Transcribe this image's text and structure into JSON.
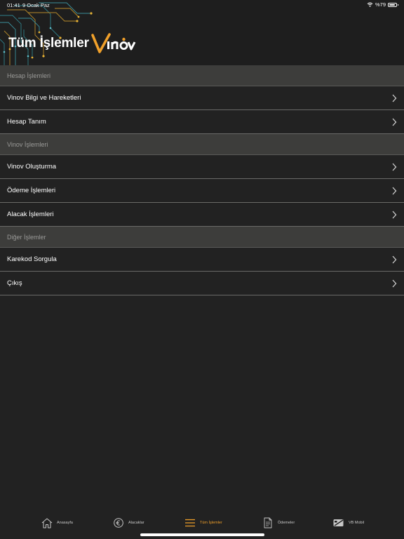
{
  "status_bar": {
    "time": "01:41",
    "date": "9 Ocak Paz",
    "battery": "%79"
  },
  "header": {
    "title": "Tüm İşlemler",
    "logo": "Vinov",
    "accent": "#f0a02a"
  },
  "sections": [
    {
      "title": "Hesap İşlemleri",
      "items": [
        {
          "label": "Vinov Bilgi ve Hareketleri"
        },
        {
          "label": "Hesap Tanım"
        }
      ]
    },
    {
      "title": "Vinov İşlemleri",
      "items": [
        {
          "label": "Vinov Oluşturma"
        },
        {
          "label": "Ödeme İşlemleri"
        },
        {
          "label": "Alacak İşlemleri"
        }
      ]
    },
    {
      "title": "Diğer İşlemler",
      "items": [
        {
          "label": "Karekod Sorgula"
        },
        {
          "label": "Çıkış"
        }
      ]
    }
  ],
  "tabbar": {
    "tabs": [
      {
        "label": "Anasayfa",
        "icon": "home-icon"
      },
      {
        "label": "Alacaklar",
        "icon": "euro-coin-icon"
      },
      {
        "label": "Tüm İşlemler",
        "icon": "menu-icon",
        "active": true
      },
      {
        "label": "Ödemeler",
        "icon": "document-icon"
      },
      {
        "label": "VB Mobil",
        "icon": "card-icon"
      }
    ]
  }
}
